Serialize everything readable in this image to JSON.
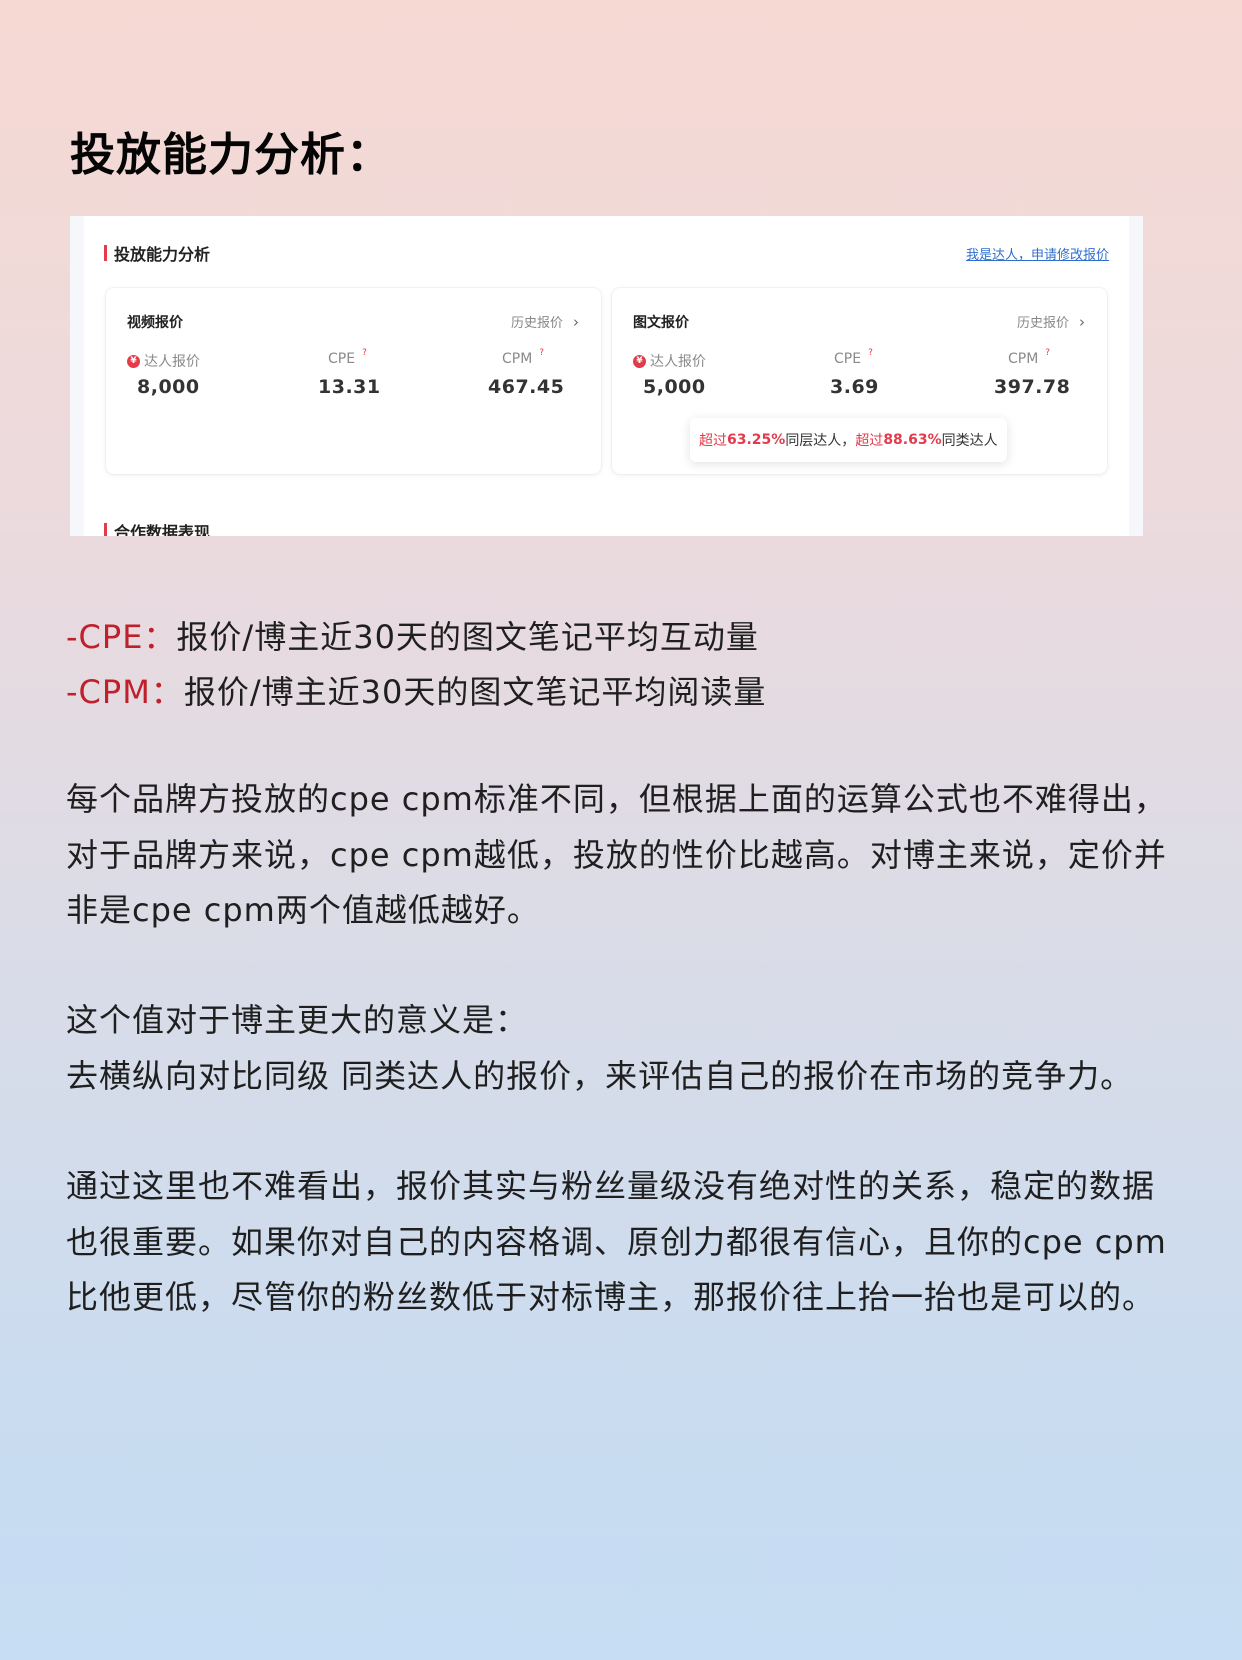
{
  "page": {
    "title": "投放能力分析："
  },
  "screenshot": {
    "section_title": "投放能力分析",
    "modify_link": "我是达人，申请修改报价",
    "next_section_title": "合作数据表现",
    "cards": [
      {
        "title": "视频报价",
        "history_label": "历史报价",
        "metrics": [
          {
            "label": "达人报价",
            "value": "8,000"
          },
          {
            "label": "CPE",
            "value": "13.31"
          },
          {
            "label": "CPM",
            "value": "467.45"
          }
        ]
      },
      {
        "title": "图文报价",
        "history_label": "历史报价",
        "metrics": [
          {
            "label": "达人报价",
            "value": "5,000"
          },
          {
            "label": "CPE",
            "value": "3.69"
          },
          {
            "label": "CPM",
            "value": "397.78"
          }
        ]
      }
    ],
    "tooltip": {
      "exceed1": "超过",
      "pct1": "63.25%",
      "text1": "同层达人，",
      "exceed2": "超过",
      "pct2": "88.63%",
      "text2": "同类达人"
    },
    "yen_icon": "¥",
    "question_icon": "?"
  },
  "definitions": [
    {
      "key": "-CPE：",
      "text": "报价/博主近30天的图文笔记平均互动量"
    },
    {
      "key": "-CPM：",
      "text": "报价/博主近30天的图文笔记平均阅读量"
    }
  ],
  "paragraphs": {
    "p1": "每个品牌方投放的cpe cpm标准不同，但根据上面的运算公式也不难得出，对于品牌方来说，cpe cpm越低，投放的性价比越高。对博主来说，定价并非是cpe cpm两个值越低越好。",
    "p2_line1": "这个值对于博主更大的意义是：",
    "p2_line2": "去横纵向对比同级 同类达人的报价，来评估自己的报价在市场的竞争力。",
    "p3": "通过这里也不难看出，报价其实与粉丝量级没有绝对性的关系，稳定的数据也很重要。如果你对自己的内容格调、原创力都很有信心，且你的cpe cpm比他更低，尽管你的粉丝数低于对标博主，那报价往上抬一抬也是可以的。"
  },
  "colors": {
    "accent_red": "#e33b4c",
    "definition_red": "#c0202b",
    "link_blue": "#2f6fcf"
  }
}
